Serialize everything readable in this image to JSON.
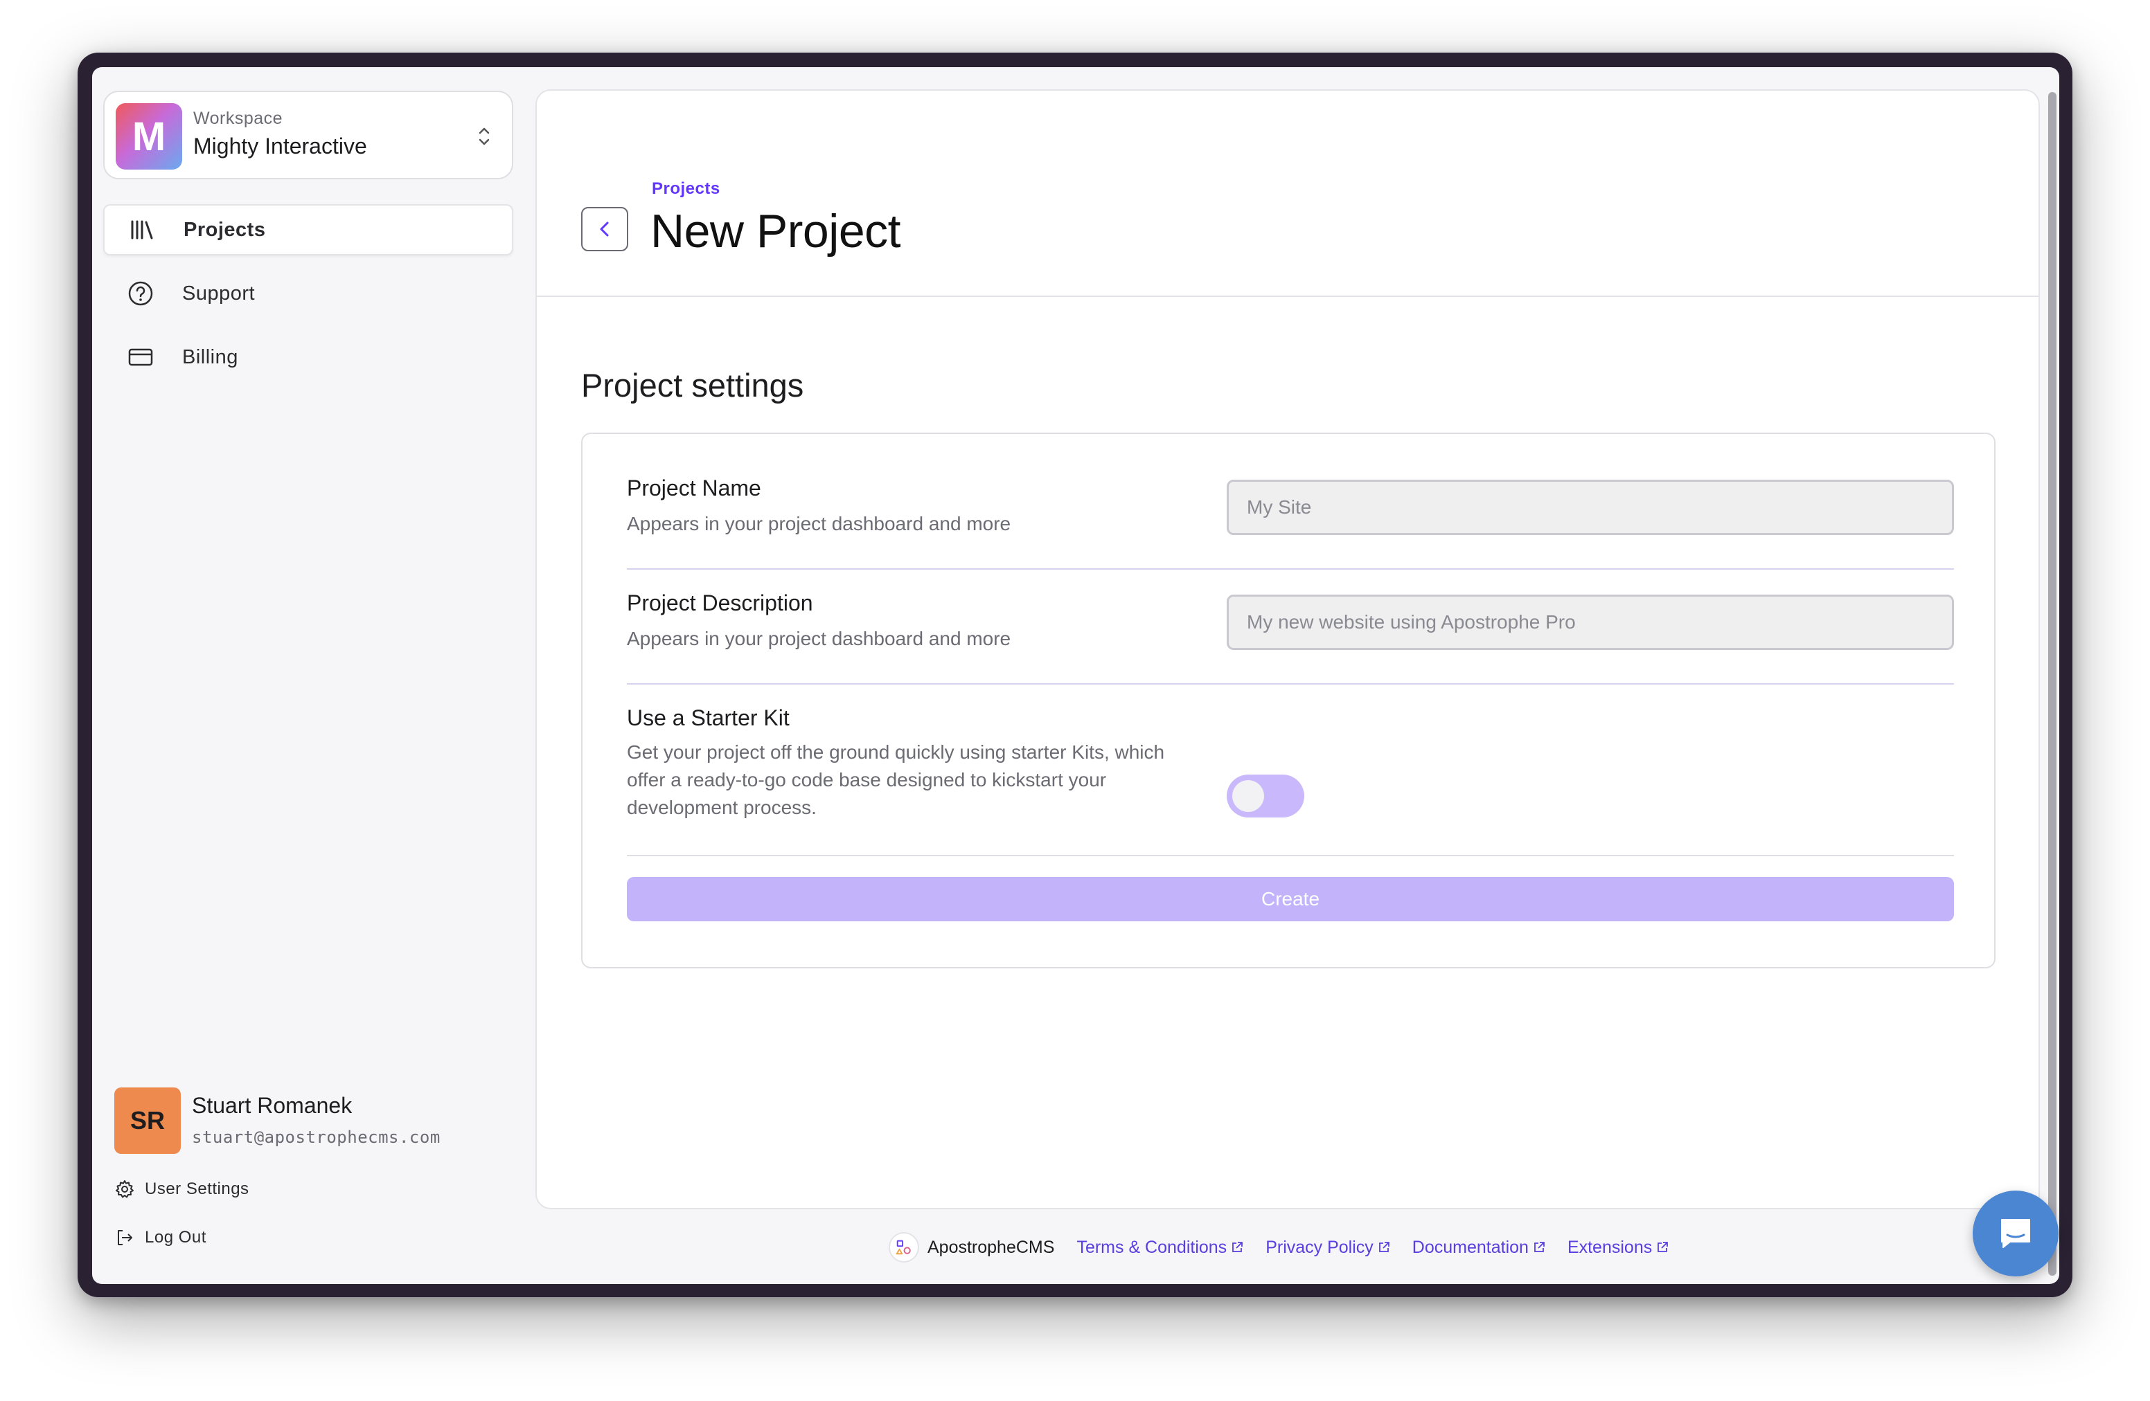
{
  "workspace": {
    "logo_letter": "M",
    "label": "Workspace",
    "name": "Mighty Interactive"
  },
  "nav": {
    "items": [
      {
        "label": "Projects",
        "icon": "library-icon",
        "active": true
      },
      {
        "label": "Support",
        "icon": "help-circle-icon",
        "active": false
      },
      {
        "label": "Billing",
        "icon": "credit-card-icon",
        "active": false
      }
    ]
  },
  "user": {
    "initials": "SR",
    "name": "Stuart Romanek",
    "email": "stuart@apostrophecms.com",
    "settings_label": "User Settings",
    "logout_label": "Log Out"
  },
  "header": {
    "breadcrumb": "Projects",
    "title": "New Project"
  },
  "settings": {
    "section_title": "Project settings",
    "fields": [
      {
        "label": "Project Name",
        "help": "Appears in your project dashboard and more",
        "value": "",
        "placeholder": "My Site"
      },
      {
        "label": "Project Description",
        "help": "Appears in your project dashboard and more",
        "value": "",
        "placeholder": "My new website using Apostrophe Pro"
      }
    ],
    "starter_kit": {
      "label": "Use a Starter Kit",
      "help": "Get your project off the ground quickly using starter Kits, which offer a ready-to-go code base designed to kickstart your development process.",
      "enabled": false
    },
    "create_label": "Create"
  },
  "footer": {
    "brand": "ApostropheCMS",
    "links": [
      "Terms & Conditions",
      "Privacy Policy",
      "Documentation",
      "Extensions"
    ]
  },
  "colors": {
    "accent": "#6236ff",
    "link": "#5a3ee0",
    "button_disabled": "#c2b3fa",
    "toggle_off": "#c9b8fb",
    "avatar_user": "#ee8a4e",
    "chat": "#4a86d2"
  }
}
